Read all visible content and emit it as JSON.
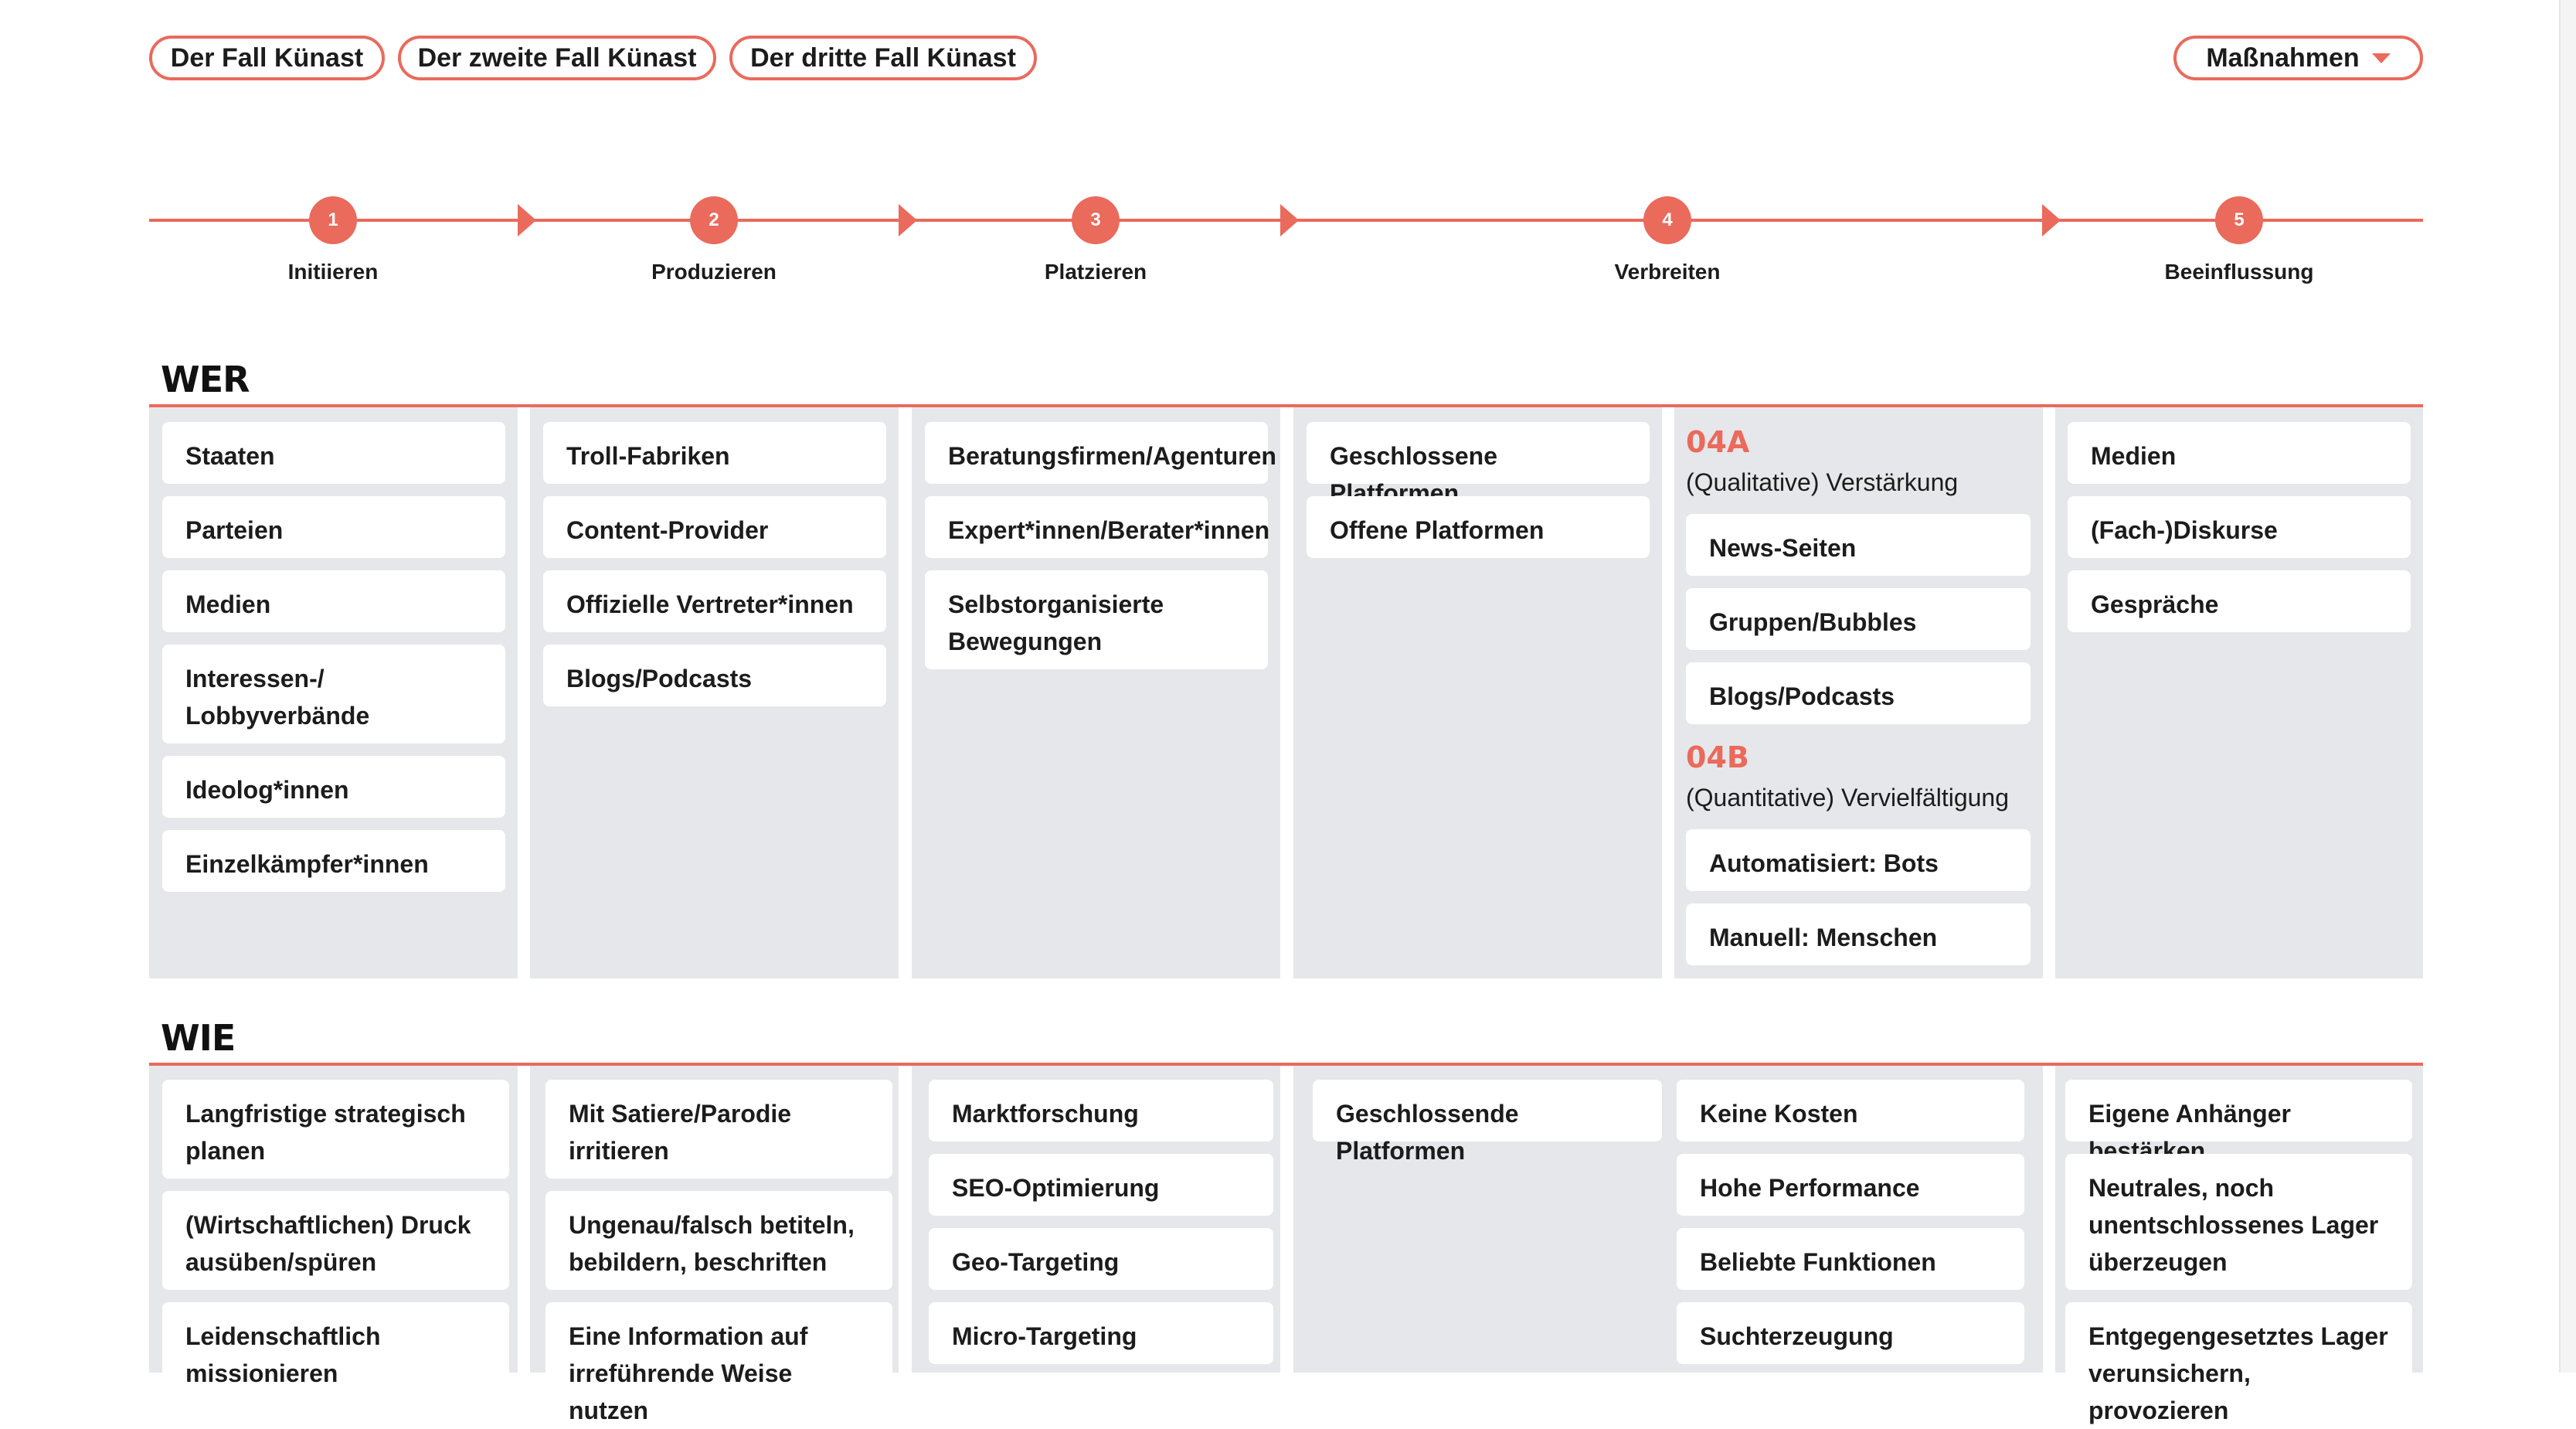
{
  "case_tabs": [
    "Der Fall Künast",
    "Der zweite Fall Künast",
    "Der dritte Fall Künast"
  ],
  "measures_label": "Maßnahmen",
  "colors": {
    "accent": "#ea6a5c",
    "column_bg": "#e6e7ea",
    "card_bg": "#ffffff"
  },
  "timeline": [
    {
      "num": "1",
      "label": "Initiieren"
    },
    {
      "num": "2",
      "label": "Produzieren"
    },
    {
      "num": "3",
      "label": "Platzieren"
    },
    {
      "num": "4",
      "label": "Verbreiten"
    },
    {
      "num": "5",
      "label": "Beeinflussung"
    }
  ],
  "wer": {
    "title": "WER",
    "col1": [
      "Staaten",
      "Parteien",
      "Medien",
      "Interessen-/ Lobbyverbände",
      "Ideolog*innen",
      "Einzelkämpfer*innen"
    ],
    "col2": [
      "Troll-Fabriken",
      "Content-Provider",
      "Offizielle Vertreter*innen",
      "Blogs/Podcasts"
    ],
    "col3": [
      "Beratungsfirmen/Agenturen",
      "Expert*innen/Berater*innen",
      "Selbstorganisierte Bewegungen"
    ],
    "col4": [
      "Geschlossene Platformen",
      "Offene Platformen"
    ],
    "col5": {
      "a_head": "04A",
      "a_desc": "(Qualitative) Verstärkung",
      "a_items": [
        "News-Seiten",
        "Gruppen/Bubbles",
        "Blogs/Podcasts"
      ],
      "b_head": "04B",
      "b_desc": "(Quantitative) Vervielfältigung",
      "b_items": [
        "Automatisiert: Bots",
        "Manuell: Menschen"
      ]
    },
    "col6": [
      "Medien",
      "(Fach-)Diskurse",
      "Gespräche"
    ]
  },
  "wie": {
    "title": "WIE",
    "col1": [
      "Langfristige strategisch planen",
      "(Wirtschaftlichen) Druck ausüben/spüren",
      "Leidenschaftlich missionieren"
    ],
    "col2": [
      "Mit Satiere/Parodie irritieren",
      "Ungenau/falsch betiteln, bebildern, beschriften",
      "Eine Information auf irreführende Weise nutzen"
    ],
    "col3": [
      "Marktforschung",
      "SEO-Optimierung",
      "Geo-Targeting",
      "Micro-Targeting"
    ],
    "col4a": [
      "Geschlossende Platformen"
    ],
    "col4b": [
      "Keine Kosten",
      "Hohe Performance",
      "Beliebte Funktionen",
      "Suchterzeugung"
    ],
    "col6": [
      "Eigene Anhänger bestärken",
      "Neutrales, noch unentschlossenes Lager überzeugen",
      "Entgegengesetztes Lager verunsichern, provozieren"
    ]
  }
}
